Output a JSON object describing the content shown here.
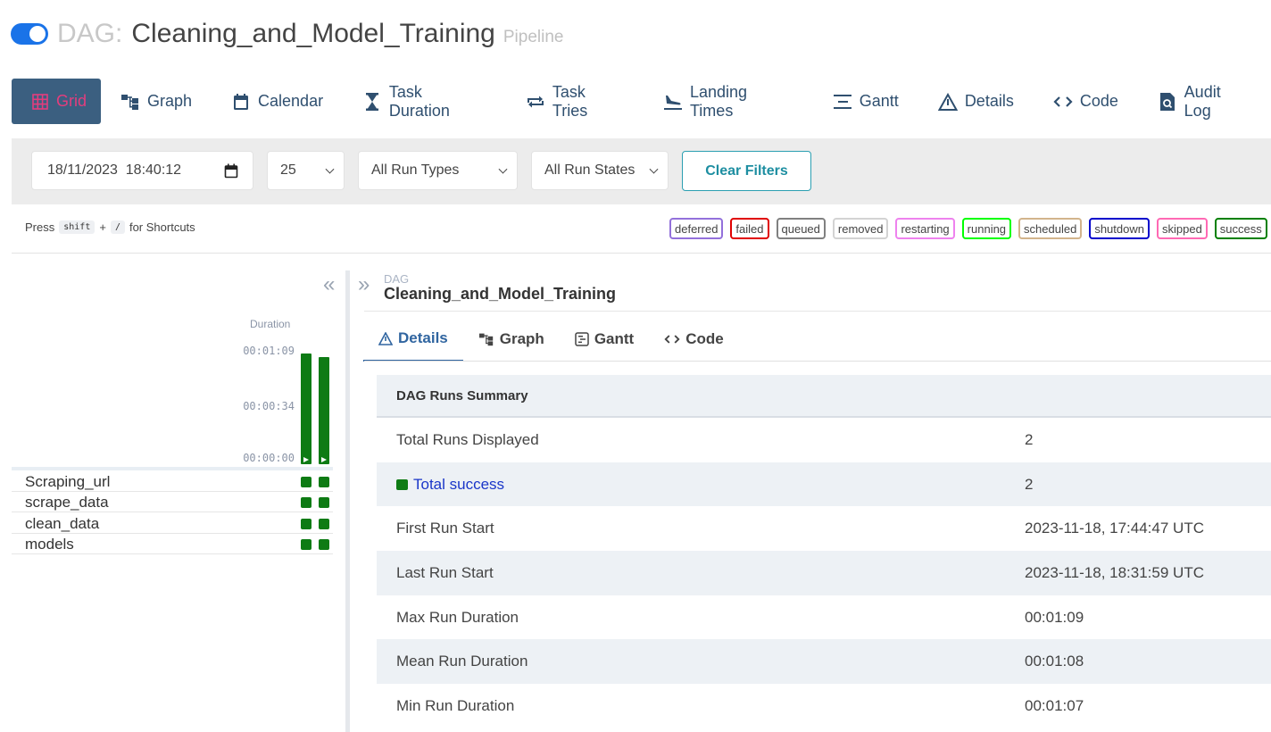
{
  "header": {
    "prefix": "DAG:",
    "title": "Cleaning_and_Model_Training",
    "subtitle": "Pipeline"
  },
  "nav": {
    "grid": "Grid",
    "graph": "Graph",
    "calendar": "Calendar",
    "task_duration": "Task Duration",
    "task_tries": "Task Tries",
    "landing_times": "Landing Times",
    "gantt": "Gantt",
    "details": "Details",
    "code": "Code",
    "audit_log": "Audit Log"
  },
  "filters": {
    "datetime": "18/11/2023  18:40:12",
    "num_runs": "25",
    "run_types": "All Run Types",
    "run_states": "All Run States",
    "clear_label": "Clear Filters"
  },
  "shortcut": {
    "press": "Press",
    "key1": "shift",
    "plus": "+",
    "key2": "/",
    "suffix": "for Shortcuts"
  },
  "legend": [
    {
      "label": "deferred",
      "color": "#9370db"
    },
    {
      "label": "failed",
      "color": "#e00000"
    },
    {
      "label": "queued",
      "color": "#808080"
    },
    {
      "label": "removed",
      "color": "#d3d3d3"
    },
    {
      "label": "restarting",
      "color": "#ee82ee"
    },
    {
      "label": "running",
      "color": "#00ff00"
    },
    {
      "label": "scheduled",
      "color": "#d2b48c"
    },
    {
      "label": "shutdown",
      "color": "#0000cc"
    },
    {
      "label": "skipped",
      "color": "#ff69b4"
    },
    {
      "label": "success",
      "color": "#008000"
    }
  ],
  "grid": {
    "duration_label": "Duration",
    "ticks": [
      "00:01:09",
      "00:00:34",
      "00:00:00"
    ],
    "runs": [
      {
        "duration_seconds": 69,
        "state": "success"
      },
      {
        "duration_seconds": 67,
        "state": "success"
      }
    ],
    "tasks": [
      {
        "name": "Scraping_url"
      },
      {
        "name": "scrape_data"
      },
      {
        "name": "clean_data"
      },
      {
        "name": "models"
      }
    ]
  },
  "details": {
    "dag_small": "DAG",
    "dag_name": "Cleaning_and_Model_Training",
    "tabs": {
      "details": "Details",
      "graph": "Graph",
      "gantt": "Gantt",
      "code": "Code"
    },
    "summary_title": "DAG Runs Summary",
    "rows": [
      {
        "label": "Total Runs Displayed",
        "value": "2"
      },
      {
        "label": "Total success",
        "value": "2"
      },
      {
        "label": "First Run Start",
        "value": "2023-11-18, 17:44:47 UTC"
      },
      {
        "label": "Last Run Start",
        "value": "2023-11-18, 18:31:59 UTC"
      },
      {
        "label": "Max Run Duration",
        "value": "00:01:09"
      },
      {
        "label": "Mean Run Duration",
        "value": "00:01:08"
      },
      {
        "label": "Min Run Duration",
        "value": "00:01:07"
      }
    ]
  },
  "colors": {
    "success": "#0e7b14",
    "accent": "#3b5f80"
  }
}
